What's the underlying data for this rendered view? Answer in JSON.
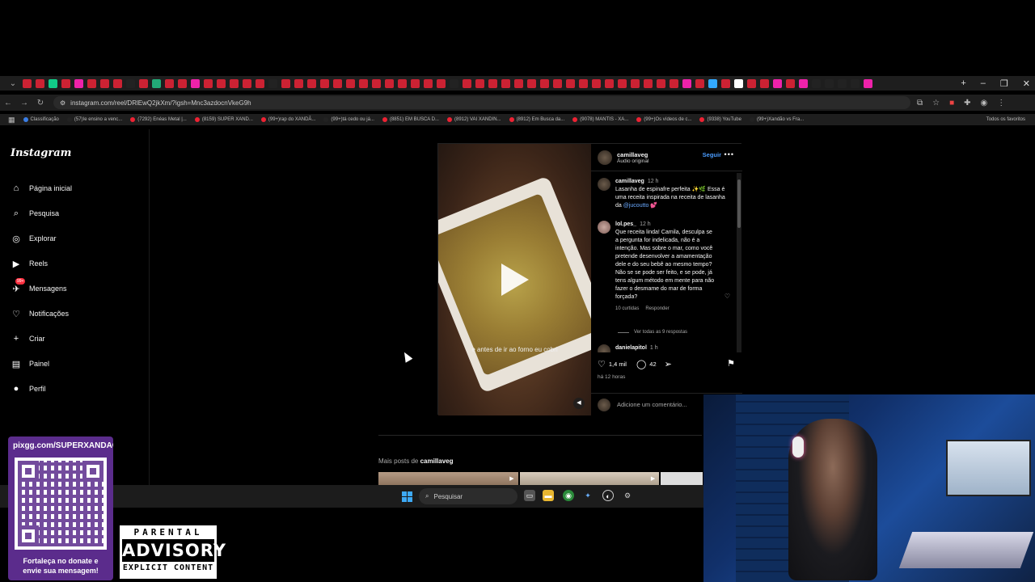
{
  "browser": {
    "url": "instagram.com/reel/DRlEwQ2jkXm/?igsh=Mnc3azdocnVkeG9h",
    "win_controls": [
      "–",
      "❐",
      "✕"
    ],
    "tab_colors": [
      "#c23",
      "#c23",
      "#1c8",
      "#c23",
      "#e2a",
      "#c23",
      "#c23",
      "#c23",
      "#222",
      "#c23",
      "#2a7",
      "#c23",
      "#c23",
      "#e2a",
      "#c23",
      "#c23",
      "#c23",
      "#c23",
      "#c23",
      "#222",
      "#c23",
      "#c23",
      "#c23",
      "#c23",
      "#c23",
      "#c23",
      "#c23",
      "#c23",
      "#c23",
      "#c23",
      "#c23",
      "#c23",
      "#c23",
      "#222",
      "#c23",
      "#c23",
      "#c23",
      "#c23",
      "#c23",
      "#c23",
      "#c23",
      "#c23",
      "#c23",
      "#c23",
      "#c23",
      "#c23",
      "#c23",
      "#c23",
      "#c23",
      "#c23",
      "#c23",
      "#e2a",
      "#c23",
      "#3af",
      "#c23",
      "#fff",
      "#c23",
      "#c23",
      "#e2a",
      "#c23",
      "#e2a",
      "#222",
      "#222",
      "#222",
      "#222",
      "#e2a"
    ],
    "bookmarks": [
      {
        "label": "Classificação",
        "color": "#3a7ee6"
      },
      {
        "label": "(57)Ie ensino a venc...",
        "color": "#222"
      },
      {
        "label": "(7292) Enéas Metal |...",
        "color": "#e23"
      },
      {
        "label": "(8159) SUPER XAND...",
        "color": "#e23"
      },
      {
        "label": "(99+)rap do XANDÃ...",
        "color": "#e23"
      },
      {
        "label": "(99+)tá cedo ou já...",
        "color": "#222"
      },
      {
        "label": "(8851) EM BUSCA D...",
        "color": "#e23"
      },
      {
        "label": "(8912) VAI XANDIN...",
        "color": "#e23"
      },
      {
        "label": "(8912) Em Busca da...",
        "color": "#e23"
      },
      {
        "label": "(9078) MANTIS - XA...",
        "color": "#e23"
      },
      {
        "label": "(99+)Os vídeos de c...",
        "color": "#e23"
      },
      {
        "label": "(9338) YouTube",
        "color": "#e23"
      },
      {
        "label": "(99+)Xandão vs Fra...",
        "color": "#222"
      }
    ],
    "all_bookmarks": "Todos os favoritos"
  },
  "sidebar": {
    "logo": "Instagram",
    "items": [
      {
        "label": "Página inicial",
        "icon": "⌂"
      },
      {
        "label": "Pesquisa",
        "icon": "⌕"
      },
      {
        "label": "Explorar",
        "icon": "◎"
      },
      {
        "label": "Reels",
        "icon": "▶"
      },
      {
        "label": "Mensagens",
        "icon": "✈",
        "badge": "99+"
      },
      {
        "label": "Notificações",
        "icon": "♡"
      },
      {
        "label": "Criar",
        "icon": "+"
      },
      {
        "label": "Painel",
        "icon": "▤"
      },
      {
        "label": "Perfil",
        "icon": "●"
      }
    ]
  },
  "post": {
    "username": "camillaveg",
    "audio": "Áudio original",
    "follow": "Seguir",
    "video_caption": "e antes de ir ao forno eu cobri",
    "caption": {
      "user": "camillaveg",
      "time": "12 h",
      "text": "Lasanha de espinafre perfeita ✨🌿 Essa é uma receita inspirada na receita de lasanha da",
      "mention": "@jucoutto 💕"
    },
    "comment": {
      "user": "lol.pes_",
      "time": "12 h",
      "text": "Que receita linda! Camila, desculpa se a pergunta for indelicada, não é a intenção. Mas sobre o mar, como você pretende desenvolver a amamentação dele e do seu bebê ao mesmo tempo? Não se se pode ser feito, e se pode, já tens algum método em mente para não fazer o desmame do mar de forma forçada?",
      "likes": "10 curtidas",
      "reply": "Responder",
      "view_replies": "Ver todas as 9 respostas"
    },
    "comment2": {
      "user": "danielapitol",
      "time": "1 h"
    },
    "likes": "1,4 mil",
    "comments_count": "42",
    "ago": "há 12 horas",
    "add_comment": "Adicione um comentário..."
  },
  "more_posts": {
    "prefix": "Mais posts de",
    "user": "camillaveg"
  },
  "taskbar": {
    "search": "Pesquisar"
  },
  "overlay": {
    "qr_url": "pixgg.com/SUPERXANDAO",
    "qr_note_1": "Fortaleça no donate e",
    "qr_note_2": "envie sua mensagem!",
    "advisory_1": "PARENTAL",
    "advisory_2": "ADVISORY",
    "advisory_3": "EXPLICIT CONTENT"
  }
}
